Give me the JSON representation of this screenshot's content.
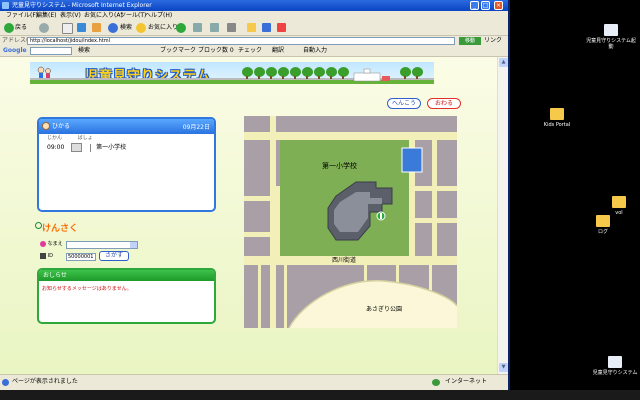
{
  "window": {
    "title": "児童見守りシステム - Microsoft Internet Explorer",
    "min": "_",
    "max": "□",
    "close": "×"
  },
  "menu": [
    "ファイル(F)",
    "編集(E)",
    "表示(V)",
    "お気に入り(A)",
    "ツール(T)",
    "ヘルプ(H)"
  ],
  "toolbar": {
    "back_label": "戻る",
    "search_label": "検索",
    "favorites_label": "お気に入り"
  },
  "address": {
    "label": "アドレス(D)",
    "url": "http://localhost/jidou/index.html",
    "go_label": "移動",
    "links_label": "リンク"
  },
  "googlebar": {
    "brand": "Google",
    "search_label": "検索",
    "bookmark_label": "ブックマーク",
    "blocked_label": "ブロック数 0",
    "check_label": "チェック",
    "translate_label": "翻訳",
    "autofill_label": "自動入力"
  },
  "app": {
    "title": "児童見守りシステム",
    "change_button": "へんこう",
    "end_button": "おわる"
  },
  "schedule": {
    "user": "ひかる",
    "date": "09月22日",
    "col_time": "じかん",
    "col_place": "ばしょ",
    "rows": [
      {
        "time": "09:00",
        "place": "第一小学校"
      }
    ]
  },
  "search": {
    "title": "けんさく",
    "name_label": "なまえ",
    "name_value": "",
    "id_label": "ID",
    "id_value": "50000001",
    "button": "さがす"
  },
  "notice": {
    "title": "おしらせ",
    "message": "お知らせするメッセージはありません。"
  },
  "map": {
    "school_label": "第一小学校",
    "road_label": "西川街道",
    "park_label": "あさぎり公園"
  },
  "status": {
    "text": "ページが表示されました",
    "zone": "インターネット"
  },
  "desktop_icons": [
    "児童見守りシステム起動",
    "Kids Portal",
    "vol",
    "ログ",
    "児童見守りシステム"
  ],
  "colors": {
    "brand_blue": "#2f78e0",
    "accent_orange": "#ff6a00",
    "notice_green": "#2ea83a",
    "map_road": "#f3efb9",
    "map_field": "#7faf55"
  }
}
